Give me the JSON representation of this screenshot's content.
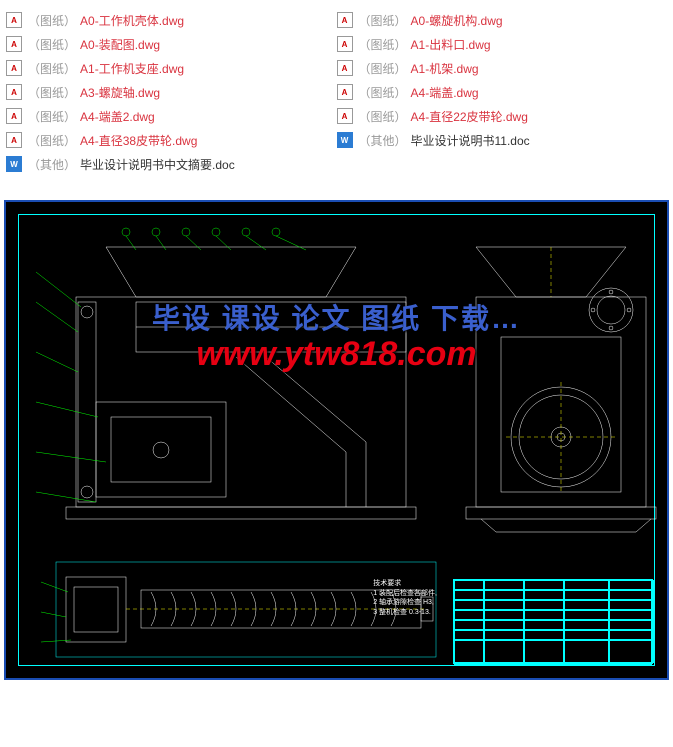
{
  "file_list": {
    "left_column": [
      {
        "icon": "A",
        "tag": "（图纸）",
        "name": "A0-工作机壳体.dwg",
        "type": "dwg"
      },
      {
        "icon": "A",
        "tag": "（图纸）",
        "name": "A0-装配图.dwg",
        "type": "dwg"
      },
      {
        "icon": "A",
        "tag": "（图纸）",
        "name": "A1-工作机支座.dwg",
        "type": "dwg"
      },
      {
        "icon": "A",
        "tag": "（图纸）",
        "name": "A3-螺旋轴.dwg",
        "type": "dwg"
      },
      {
        "icon": "A",
        "tag": "（图纸）",
        "name": "A4-端盖2.dwg",
        "type": "dwg"
      },
      {
        "icon": "A",
        "tag": "（图纸）",
        "name": "A4-直径38皮带轮.dwg",
        "type": "dwg"
      },
      {
        "icon": "W",
        "tag": "（其他）",
        "name": "毕业设计说明书中文摘要.doc",
        "type": "doc"
      }
    ],
    "right_column": [
      {
        "icon": "A",
        "tag": "（图纸）",
        "name": "A0-螺旋机构.dwg",
        "type": "dwg"
      },
      {
        "icon": "A",
        "tag": "（图纸）",
        "name": "A1-出料口.dwg",
        "type": "dwg"
      },
      {
        "icon": "A",
        "tag": "（图纸）",
        "name": "A1-机架.dwg",
        "type": "dwg"
      },
      {
        "icon": "A",
        "tag": "（图纸）",
        "name": "A4-端盖.dwg",
        "type": "dwg"
      },
      {
        "icon": "A",
        "tag": "（图纸）",
        "name": "A4-直径22皮带轮.dwg",
        "type": "dwg"
      },
      {
        "icon": "W",
        "tag": "（其他）",
        "name": "毕业设计说明书11.doc",
        "type": "doc"
      }
    ]
  },
  "watermark": {
    "line1": "毕设 课设 论文 图纸 下载…",
    "line2": "www.ytw818.com"
  },
  "tech_note": {
    "title": "技术要求",
    "line1": "1 装配后检查各部件,",
    "line2": "2 轴承游隙检查 H3,",
    "line3": "3 整机检查 0.3-13."
  }
}
